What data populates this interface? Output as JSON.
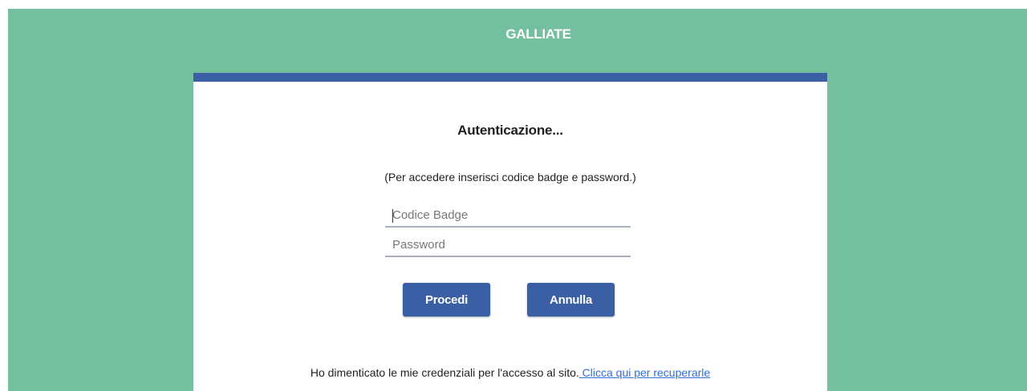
{
  "header": {
    "site_title": "GALLIATE"
  },
  "login": {
    "title": "Autenticazione...",
    "hint": "(Per accedere inserisci codice badge e password.)",
    "badge_placeholder": "Codice Badge",
    "badge_value": "",
    "password_placeholder": "Password",
    "password_value": "",
    "submit_label": "Procedi",
    "cancel_label": "Annulla",
    "recover_text": "Ho dimenticato le mie credenziali per l'accesso al sito.",
    "recover_link": " Clicca qui per recuperarle"
  },
  "colors": {
    "page_background": "#73bf9f",
    "accent": "#3b5fa4",
    "link": "#2f6fd6"
  }
}
